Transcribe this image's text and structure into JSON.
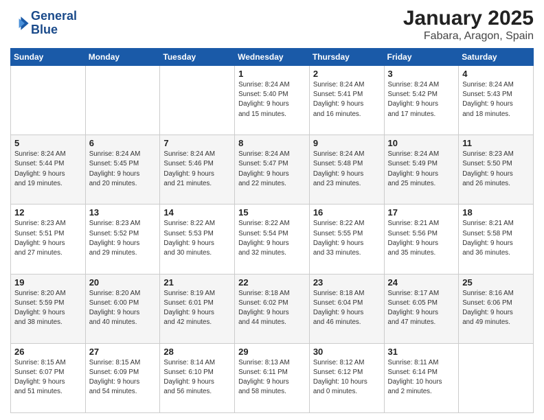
{
  "header": {
    "logo_line1": "General",
    "logo_line2": "Blue",
    "title": "January 2025",
    "subtitle": "Fabara, Aragon, Spain"
  },
  "weekdays": [
    "Sunday",
    "Monday",
    "Tuesday",
    "Wednesday",
    "Thursday",
    "Friday",
    "Saturday"
  ],
  "weeks": [
    [
      {
        "day": "",
        "info": ""
      },
      {
        "day": "",
        "info": ""
      },
      {
        "day": "",
        "info": ""
      },
      {
        "day": "1",
        "info": "Sunrise: 8:24 AM\nSunset: 5:40 PM\nDaylight: 9 hours\nand 15 minutes."
      },
      {
        "day": "2",
        "info": "Sunrise: 8:24 AM\nSunset: 5:41 PM\nDaylight: 9 hours\nand 16 minutes."
      },
      {
        "day": "3",
        "info": "Sunrise: 8:24 AM\nSunset: 5:42 PM\nDaylight: 9 hours\nand 17 minutes."
      },
      {
        "day": "4",
        "info": "Sunrise: 8:24 AM\nSunset: 5:43 PM\nDaylight: 9 hours\nand 18 minutes."
      }
    ],
    [
      {
        "day": "5",
        "info": "Sunrise: 8:24 AM\nSunset: 5:44 PM\nDaylight: 9 hours\nand 19 minutes."
      },
      {
        "day": "6",
        "info": "Sunrise: 8:24 AM\nSunset: 5:45 PM\nDaylight: 9 hours\nand 20 minutes."
      },
      {
        "day": "7",
        "info": "Sunrise: 8:24 AM\nSunset: 5:46 PM\nDaylight: 9 hours\nand 21 minutes."
      },
      {
        "day": "8",
        "info": "Sunrise: 8:24 AM\nSunset: 5:47 PM\nDaylight: 9 hours\nand 22 minutes."
      },
      {
        "day": "9",
        "info": "Sunrise: 8:24 AM\nSunset: 5:48 PM\nDaylight: 9 hours\nand 23 minutes."
      },
      {
        "day": "10",
        "info": "Sunrise: 8:24 AM\nSunset: 5:49 PM\nDaylight: 9 hours\nand 25 minutes."
      },
      {
        "day": "11",
        "info": "Sunrise: 8:23 AM\nSunset: 5:50 PM\nDaylight: 9 hours\nand 26 minutes."
      }
    ],
    [
      {
        "day": "12",
        "info": "Sunrise: 8:23 AM\nSunset: 5:51 PM\nDaylight: 9 hours\nand 27 minutes."
      },
      {
        "day": "13",
        "info": "Sunrise: 8:23 AM\nSunset: 5:52 PM\nDaylight: 9 hours\nand 29 minutes."
      },
      {
        "day": "14",
        "info": "Sunrise: 8:22 AM\nSunset: 5:53 PM\nDaylight: 9 hours\nand 30 minutes."
      },
      {
        "day": "15",
        "info": "Sunrise: 8:22 AM\nSunset: 5:54 PM\nDaylight: 9 hours\nand 32 minutes."
      },
      {
        "day": "16",
        "info": "Sunrise: 8:22 AM\nSunset: 5:55 PM\nDaylight: 9 hours\nand 33 minutes."
      },
      {
        "day": "17",
        "info": "Sunrise: 8:21 AM\nSunset: 5:56 PM\nDaylight: 9 hours\nand 35 minutes."
      },
      {
        "day": "18",
        "info": "Sunrise: 8:21 AM\nSunset: 5:58 PM\nDaylight: 9 hours\nand 36 minutes."
      }
    ],
    [
      {
        "day": "19",
        "info": "Sunrise: 8:20 AM\nSunset: 5:59 PM\nDaylight: 9 hours\nand 38 minutes."
      },
      {
        "day": "20",
        "info": "Sunrise: 8:20 AM\nSunset: 6:00 PM\nDaylight: 9 hours\nand 40 minutes."
      },
      {
        "day": "21",
        "info": "Sunrise: 8:19 AM\nSunset: 6:01 PM\nDaylight: 9 hours\nand 42 minutes."
      },
      {
        "day": "22",
        "info": "Sunrise: 8:18 AM\nSunset: 6:02 PM\nDaylight: 9 hours\nand 44 minutes."
      },
      {
        "day": "23",
        "info": "Sunrise: 8:18 AM\nSunset: 6:04 PM\nDaylight: 9 hours\nand 46 minutes."
      },
      {
        "day": "24",
        "info": "Sunrise: 8:17 AM\nSunset: 6:05 PM\nDaylight: 9 hours\nand 47 minutes."
      },
      {
        "day": "25",
        "info": "Sunrise: 8:16 AM\nSunset: 6:06 PM\nDaylight: 9 hours\nand 49 minutes."
      }
    ],
    [
      {
        "day": "26",
        "info": "Sunrise: 8:15 AM\nSunset: 6:07 PM\nDaylight: 9 hours\nand 51 minutes."
      },
      {
        "day": "27",
        "info": "Sunrise: 8:15 AM\nSunset: 6:09 PM\nDaylight: 9 hours\nand 54 minutes."
      },
      {
        "day": "28",
        "info": "Sunrise: 8:14 AM\nSunset: 6:10 PM\nDaylight: 9 hours\nand 56 minutes."
      },
      {
        "day": "29",
        "info": "Sunrise: 8:13 AM\nSunset: 6:11 PM\nDaylight: 9 hours\nand 58 minutes."
      },
      {
        "day": "30",
        "info": "Sunrise: 8:12 AM\nSunset: 6:12 PM\nDaylight: 10 hours\nand 0 minutes."
      },
      {
        "day": "31",
        "info": "Sunrise: 8:11 AM\nSunset: 6:14 PM\nDaylight: 10 hours\nand 2 minutes."
      },
      {
        "day": "",
        "info": ""
      }
    ]
  ]
}
